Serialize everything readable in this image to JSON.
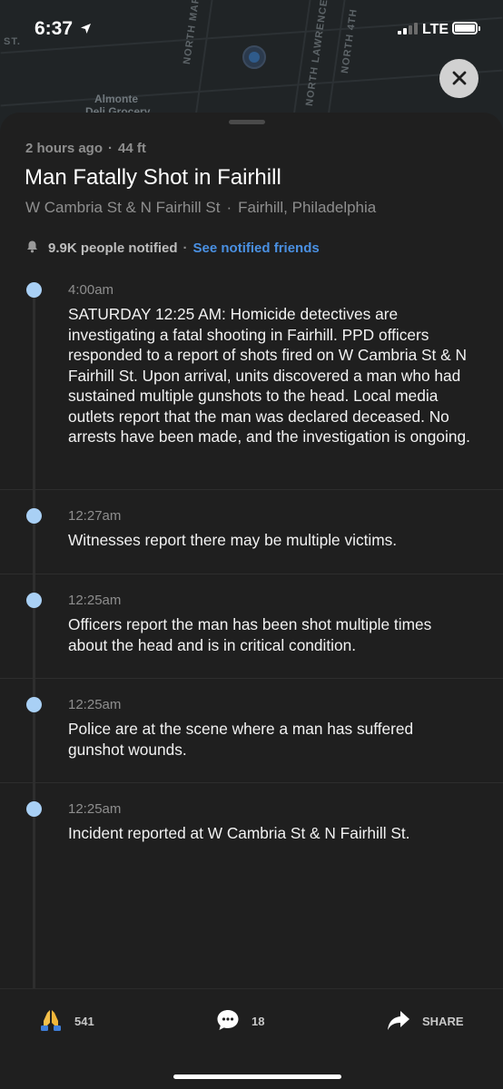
{
  "status_bar": {
    "time": "6:37",
    "network": "LTE"
  },
  "map": {
    "street_labels": [
      "ST.",
      "NORTH MARSH",
      "NORTH LAWRENCE",
      "NORTH 4TH"
    ],
    "place_label_line1": "Almonte",
    "place_label_line2": "Deli Grocery"
  },
  "incident": {
    "age": "2 hours ago",
    "distance": "44 ft",
    "title": "Man Fatally Shot in Fairhill",
    "intersection": "W Cambria St & N Fairhill St",
    "neighborhood": "Fairhill, Philadelphia",
    "notified_count": "9.9K people notified",
    "see_friends_label": "See notified friends"
  },
  "updates": [
    {
      "time": "4:00am",
      "text": "SATURDAY 12:25 AM: Homicide detectives are investigating a fatal shooting in Fairhill. PPD officers responded to a report of shots fired on W Cambria St & N Fairhill St. Upon arrival, units discovered a man who had sustained multiple gunshots to the head. Local media outlets report that the man was declared deceased. No arrests have been made, and the investigation is ongoing."
    },
    {
      "time": "12:27am",
      "text": "Witnesses report there may be multiple victims."
    },
    {
      "time": "12:25am",
      "text": "Officers report the man has been shot multiple times about the head and is in critical condition."
    },
    {
      "time": "12:25am",
      "text": "Police are at the scene where a man has suffered gunshot wounds."
    },
    {
      "time": "12:25am",
      "text": "Incident reported at W Cambria St & N Fairhill St."
    }
  ],
  "actions": {
    "thanks_count": "541",
    "comment_count": "18",
    "share_label": "SHARE"
  },
  "colors": {
    "accent": "#4a90e2",
    "timeline_dot": "#a9d0f5",
    "background": "#1f1f1f"
  },
  "icons": {
    "thanks": "praying-hands-icon",
    "comment": "comment-bubble-icon",
    "share": "share-arrow-icon",
    "close": "close-icon",
    "bell": "bell-icon"
  }
}
